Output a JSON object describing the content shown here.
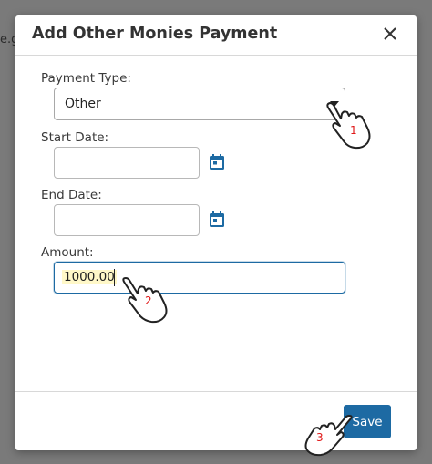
{
  "background": {
    "text": "e.g"
  },
  "dialog": {
    "title": "Add Other Monies Payment",
    "close_icon": "close-icon"
  },
  "form": {
    "payment_type": {
      "label": "Payment Type:",
      "value": "Other"
    },
    "start_date": {
      "label": "Start Date:",
      "value": "",
      "icon": "calendar-icon"
    },
    "end_date": {
      "label": "End Date:",
      "value": "",
      "icon": "calendar-icon"
    },
    "amount": {
      "label": "Amount:",
      "value": "1000.00"
    }
  },
  "footer": {
    "save_label": "Save"
  },
  "annotations": {
    "step1": "1",
    "step2": "2",
    "step3": "3"
  },
  "colors": {
    "accent": "#1d6aa3",
    "step_number": "#e01818",
    "highlight": "#fff8c8"
  }
}
